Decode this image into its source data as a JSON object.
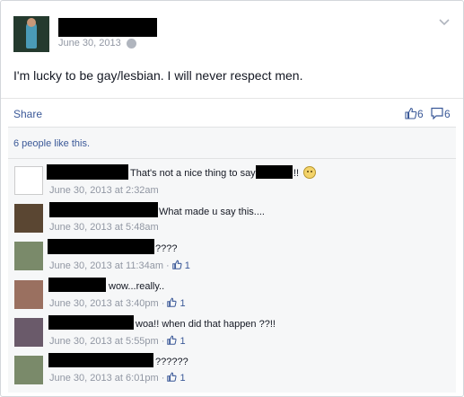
{
  "post": {
    "date": "June 30, 2013",
    "text": "I'm lucky to be gay/lesbian. I will never respect men.",
    "share_label": "Share",
    "likes_count": "6",
    "comments_count": "6",
    "likes_summary": "6 people like this."
  },
  "comments": [
    {
      "text": "That's not a nice thing to say",
      "suffix": "!!",
      "time": "June 30, 2013 at 2:32am",
      "likes": ""
    },
    {
      "text": "What made u say this....",
      "suffix": "",
      "time": "June 30, 2013 at 5:48am",
      "likes": ""
    },
    {
      "text": "????",
      "suffix": "",
      "time": "June 30, 2013 at 11:34am",
      "likes": "1"
    },
    {
      "text": "wow...really..",
      "suffix": "",
      "time": "June 30, 2013 at 3:40pm",
      "likes": "1"
    },
    {
      "text": "woa!! when did that happen ??!!",
      "suffix": "",
      "time": "June 30, 2013 at 5:55pm",
      "likes": "1"
    },
    {
      "text": "??????",
      "suffix": "",
      "time": "June 30, 2013 at 6:01pm",
      "likes": "1"
    }
  ],
  "colors": {
    "link": "#3b5998",
    "meta": "#9197a3",
    "text": "#141823"
  },
  "icons": [
    "globe-icon",
    "chevron-down-icon",
    "thumbs-up-icon",
    "comment-icon",
    "frown-emoji-icon"
  ]
}
